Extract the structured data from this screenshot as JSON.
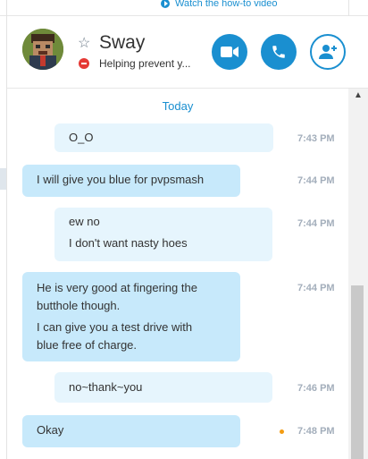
{
  "top": {
    "howto_text": "Watch the how-to video"
  },
  "contact": {
    "name": "Sway",
    "status": "Helping prevent y..."
  },
  "buttons": {
    "video": "video-call",
    "call": "audio-call",
    "add": "add-people"
  },
  "chat": {
    "day": "Today",
    "messages": [
      {
        "dir": "out",
        "lines": [
          "O_O"
        ],
        "time": "7:43 PM"
      },
      {
        "dir": "in",
        "lines": [
          "I will give you blue for pvpsmash"
        ],
        "time": "7:44 PM"
      },
      {
        "dir": "out",
        "lines": [
          "ew no",
          "I don't want nasty hoes"
        ],
        "time": "7:44 PM"
      },
      {
        "dir": "in",
        "lines": [
          "He is very good at fingering the",
          "butthole though.",
          "I can give you a test drive with",
          "blue free of charge."
        ],
        "time": "7:44 PM"
      },
      {
        "dir": "out",
        "lines": [
          "no~thank~you"
        ],
        "time": "7:46 PM"
      },
      {
        "dir": "in",
        "lines": [
          "Okay"
        ],
        "time": "7:48 PM"
      }
    ]
  },
  "colors": {
    "accent": "#1a8fd0",
    "incoming": "#c7e9fb",
    "outgoing": "#e6f5fd",
    "busy": "#e53935"
  }
}
